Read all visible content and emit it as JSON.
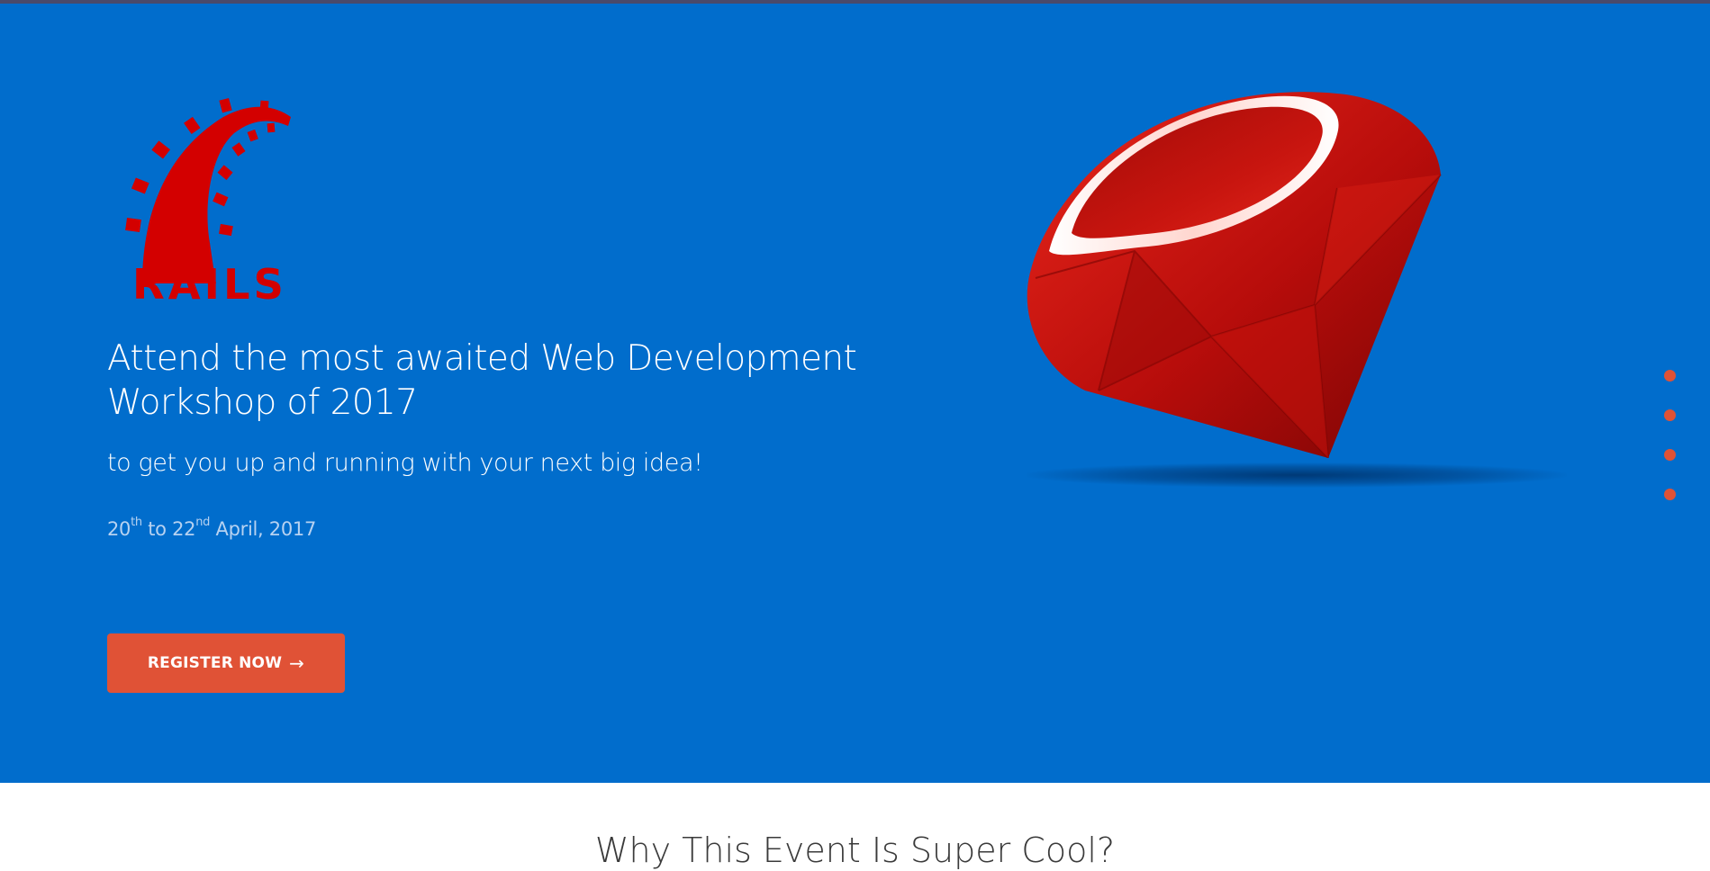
{
  "hero": {
    "background_color": "#016dcc",
    "logo": {
      "icon": "rails-logo-icon",
      "text": "RAILS",
      "color": "#d30000"
    },
    "headline": "Attend the most awaited Web Development Workshop of 2017",
    "subtitle": "to get you up and running with your next big idea!",
    "dates": {
      "start_day": "20",
      "start_suffix": "th",
      "connector": " to ",
      "end_day": "22",
      "end_suffix": "nd",
      "month_year": " April, 2017"
    },
    "register_button": {
      "label": "REGISTER NOW",
      "icon": "arrow-right-icon",
      "color": "#e05236"
    },
    "ruby_image": {
      "icon": "ruby-gem-icon"
    }
  },
  "slider_dots": {
    "count": 4,
    "color": "#e05236"
  },
  "next_section": {
    "heading": "Why This Event Is Super Cool?"
  }
}
